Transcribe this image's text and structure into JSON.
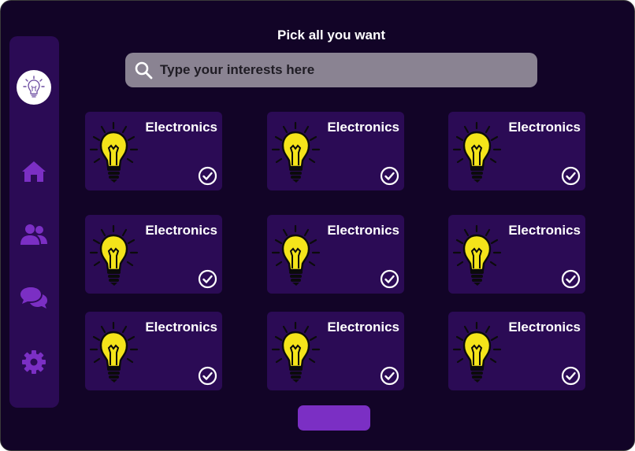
{
  "header": {
    "title": "Pick all you want"
  },
  "search": {
    "placeholder": "Type your interests here",
    "value": ""
  },
  "sidebar": {
    "logo": "lightbulb-logo-icon",
    "items": [
      {
        "icon": "home-icon"
      },
      {
        "icon": "users-icon"
      },
      {
        "icon": "chat-icon"
      },
      {
        "icon": "gear-icon"
      }
    ]
  },
  "cards": [
    {
      "label": "Electronics",
      "icon": "lightbulb-icon",
      "selected": true
    },
    {
      "label": "Electronics",
      "icon": "lightbulb-icon",
      "selected": true
    },
    {
      "label": "Electronics",
      "icon": "lightbulb-icon",
      "selected": true
    },
    {
      "label": "Electronics",
      "icon": "lightbulb-icon",
      "selected": true
    },
    {
      "label": "Electronics",
      "icon": "lightbulb-icon",
      "selected": true
    },
    {
      "label": "Electronics",
      "icon": "lightbulb-icon",
      "selected": true
    },
    {
      "label": "Electronics",
      "icon": "lightbulb-icon",
      "selected": true
    },
    {
      "label": "Electronics",
      "icon": "lightbulb-icon",
      "selected": true
    },
    {
      "label": "Electronics",
      "icon": "lightbulb-icon",
      "selected": true
    }
  ],
  "submit_button": {
    "label": ""
  },
  "colors": {
    "background": "#120427",
    "panel": "#2b0b55",
    "accent": "#7b2fc4",
    "search_bg": "#8a8392",
    "bulb": "#f4e41a"
  }
}
